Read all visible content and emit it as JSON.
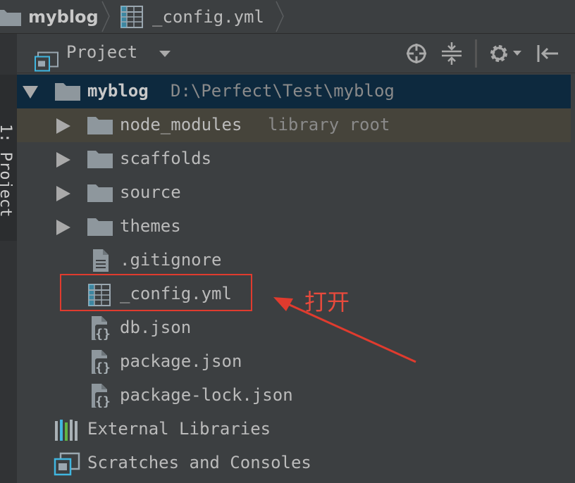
{
  "breadcrumb": {
    "project": "myblog",
    "file": "_config.yml"
  },
  "side_tab": {
    "label": "1: Project"
  },
  "panel": {
    "title": "Project",
    "icons": [
      "locate-icon",
      "collapse-all-icon",
      "settings-icon",
      "hide-panel-icon"
    ]
  },
  "tree": {
    "root": {
      "name": "myblog",
      "path": "D:\\Perfect\\Test\\myblog"
    },
    "items": [
      {
        "name": "node_modules",
        "hint": "library root",
        "type": "folder"
      },
      {
        "name": "scaffolds",
        "type": "folder"
      },
      {
        "name": "source",
        "type": "folder"
      },
      {
        "name": "themes",
        "type": "folder"
      },
      {
        "name": ".gitignore",
        "type": "text-file"
      },
      {
        "name": "_config.yml",
        "type": "yml-file"
      },
      {
        "name": "db.json",
        "type": "json-file"
      },
      {
        "name": "package.json",
        "type": "json-file"
      },
      {
        "name": "package-lock.json",
        "type": "json-file"
      }
    ],
    "external_libraries": "External Libraries",
    "scratches": "Scratches and Consoles"
  },
  "annotation": {
    "text": "打开",
    "color": "#e03b2e"
  },
  "colors": {
    "background": "#3c3f41",
    "selected_row": "#0d293e",
    "library_row": "#46443b",
    "text": "#bbbbbb",
    "folder": "#8e979d"
  }
}
